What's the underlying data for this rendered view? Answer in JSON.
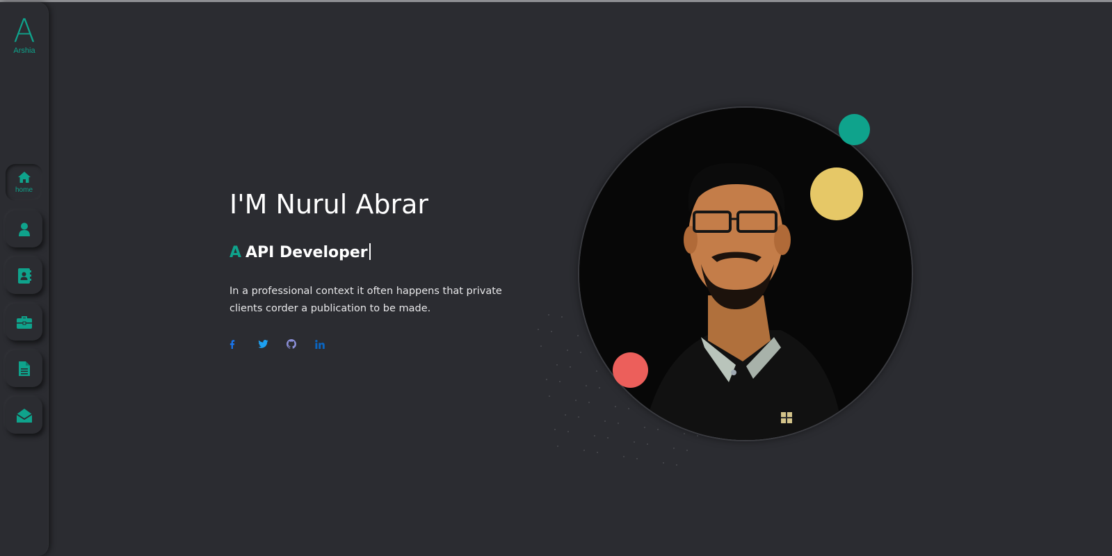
{
  "brand": {
    "letter": "A",
    "name": "Arshia",
    "accent": "#0fa38c"
  },
  "sidebar": {
    "items": [
      {
        "icon": "home-icon",
        "label": "home",
        "active": true
      },
      {
        "icon": "user-icon",
        "label": ""
      },
      {
        "icon": "contact-book-icon",
        "label": ""
      },
      {
        "icon": "briefcase-icon",
        "label": ""
      },
      {
        "icon": "document-icon",
        "label": ""
      },
      {
        "icon": "envelope-open-icon",
        "label": ""
      }
    ]
  },
  "hero": {
    "title": "I'M Nurul Abrar",
    "role_prefix": "A",
    "role": "API Developer",
    "description": "In a professional context it often happens that private clients corder a publication to be made."
  },
  "socials": [
    {
      "icon": "facebook-icon",
      "color": "#1877f2"
    },
    {
      "icon": "twitter-icon",
      "color": "#1da1f2"
    },
    {
      "icon": "github-icon",
      "color": "#8b8fd8"
    },
    {
      "icon": "linkedin-icon",
      "color": "#0a66c2"
    }
  ],
  "decor_colors": {
    "teal": "#0fa38c",
    "yellow": "#e6c867",
    "red": "#ec5f5b"
  }
}
